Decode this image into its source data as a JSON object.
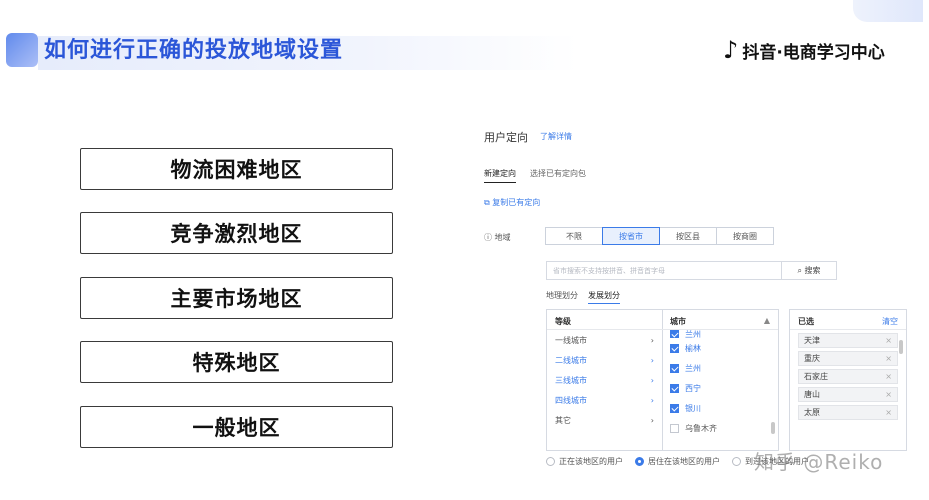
{
  "header": {
    "title": "如何进行正确的投放地域设置",
    "logo_text": "抖音·电商学习中心",
    "logo_glyph": "♪"
  },
  "regions": [
    "物流困难地区",
    "竞争激烈地区",
    "主要市场地区",
    "特殊地区",
    "一般地区"
  ],
  "panel": {
    "title": "用户定向",
    "help_link": "了解详情",
    "tabs": [
      "新建定向",
      "选择已有定向包"
    ],
    "copy_link": "复制已有定向",
    "area_label": "地域",
    "segments": [
      "不限",
      "按省市",
      "按区县",
      "按商圈"
    ],
    "search_placeholder": "省市搜索不支持按拼音、拼音首字母",
    "search_button": "搜索",
    "sub_tabs": [
      "地理划分",
      "发展划分"
    ],
    "level_header": "等级",
    "levels": [
      "一线城市",
      "二线城市",
      "三线城市",
      "四线城市",
      "其它"
    ],
    "city_header": "城市",
    "cities": [
      "榆林",
      "兰州",
      "西宁",
      "银川",
      "乌鲁木齐"
    ],
    "city_top_partial": "兰州",
    "selected_header": "已选",
    "clear_label": "清空",
    "selected": [
      "天津",
      "重庆",
      "石家庄",
      "唐山",
      "太原"
    ],
    "radios": [
      "正在该地区的用户",
      "居住在该地区的用户",
      "到过该地区的用户"
    ]
  },
  "watermark": "知乎 @Reiko"
}
